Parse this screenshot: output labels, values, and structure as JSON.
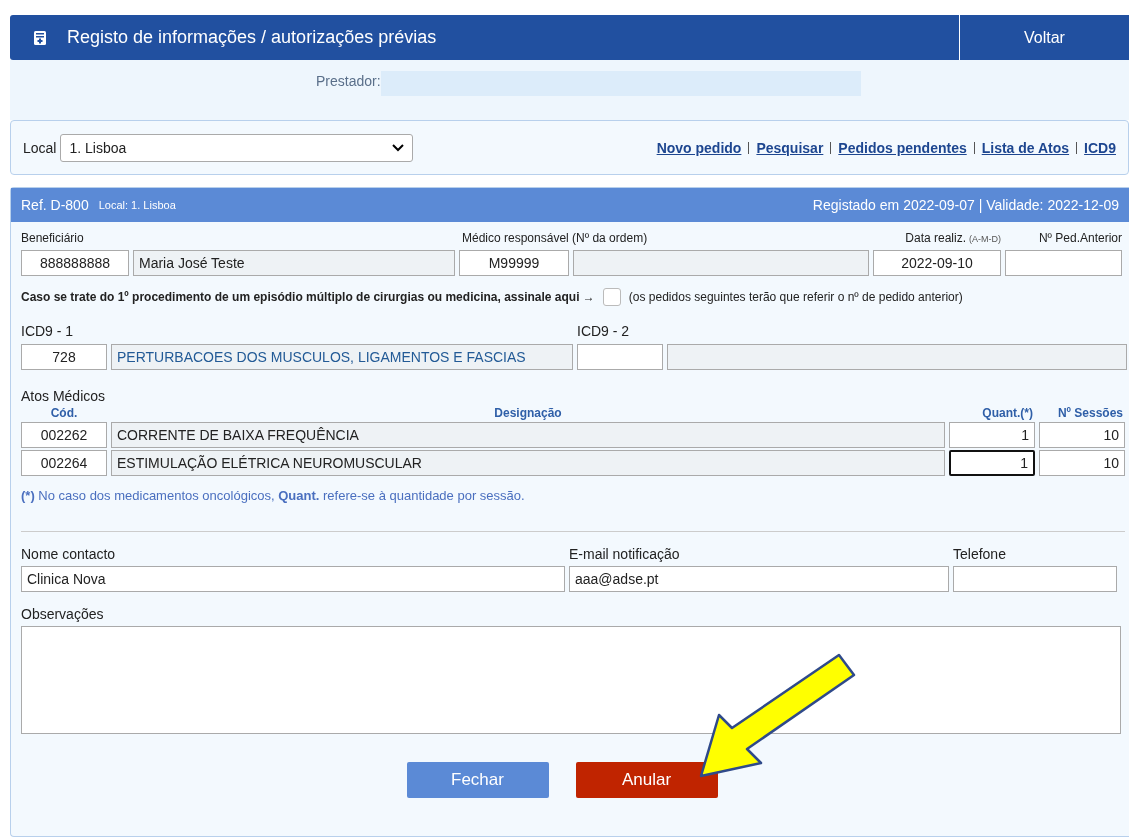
{
  "header": {
    "title": "Registo de informações / autorizações prévias",
    "back_button": "Voltar"
  },
  "provider": {
    "label": "Prestador:"
  },
  "toolbar": {
    "local_label": "Local",
    "local_value": "1. Lisboa",
    "links": [
      "Novo pedido",
      "Pesquisar",
      "Pedidos pendentes",
      "Lista de Atos",
      "ICD9"
    ]
  },
  "request": {
    "ref": "Ref. D-800",
    "local": "Local: 1. Lisboa",
    "registered": "Registado em 2022-09-07 | Validade: 2022-12-09",
    "beneficiary_label": "Beneficiário",
    "beneficiary_number": "888888888",
    "beneficiary_name": "Maria José Teste",
    "doctor_label": "Médico responsável (Nº da ordem)",
    "doctor_number": "M99999",
    "date_label": "Data realiz.",
    "date_hint": "(A-M-D)",
    "date_value": "2022-09-10",
    "previous_label": "Nº Ped.Anterior",
    "multiple_text": "Caso se trate do 1º procedimento de um episódio múltiplo de cirurgias ou medicina, assinale aqui →",
    "multiple_checked": false,
    "multiple_note": "(os pedidos seguintes terão que referir o nº de pedido anterior)",
    "icd1_label": "ICD9 - 1",
    "icd1_code": "728",
    "icd1_desc": "PERTURBACOES DOS MUSCULOS, LIGAMENTOS E FASCIAS",
    "icd2_label": "ICD9 - 2",
    "acts_label": "Atos Médicos",
    "columns": [
      "Cód.",
      "Designação",
      "Quant.(*)",
      "Nº Sessões"
    ],
    "acts": [
      {
        "code": "002262",
        "name": "CORRENTE DE BAIXA FREQUÊNCIA",
        "quantity": "1",
        "sessions": "10",
        "focused": false
      },
      {
        "code": "002264",
        "name": "ESTIMULAÇÃO ELÉTRICA NEUROMUSCULAR",
        "quantity": "1",
        "sessions": "10",
        "focused": true
      }
    ],
    "footnote": "**(*)** No caso dos medicamentos oncológicos, **Quant.** refere-se à quantidade por sessão.",
    "contact_label": "Nome contacto",
    "contact_value": "Clinica Nova",
    "email_label": "E-mail notificação",
    "email_value": "aaa@adse.pt",
    "phone_label": "Telefone",
    "notes_label": "Observações",
    "buttons": [
      {
        "label": "Fechar",
        "kind": "secondary"
      },
      {
        "label": "Anular",
        "kind": "danger"
      }
    ]
  }
}
